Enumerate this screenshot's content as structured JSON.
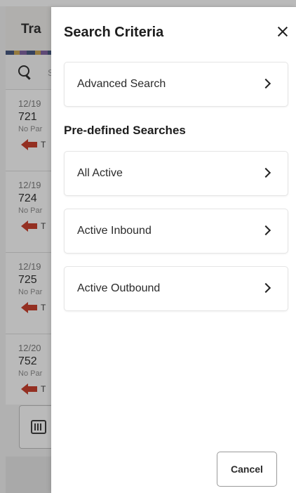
{
  "background": {
    "title": "Tra",
    "search_placeholder": "S",
    "rows": [
      {
        "date": "12/19",
        "number": "721",
        "party": "No Par",
        "type": "T"
      },
      {
        "date": "12/19",
        "number": "724",
        "party": "No Par",
        "type": "T"
      },
      {
        "date": "12/19",
        "number": "725",
        "party": "No Par",
        "type": "T"
      },
      {
        "date": "12/20",
        "number": "752",
        "party": "No Par",
        "type": "T"
      }
    ]
  },
  "drawer": {
    "title": "Search Criteria",
    "advanced_search_label": "Advanced Search",
    "predefined_heading": "Pre-defined Searches",
    "predefined_items": [
      {
        "label": "All Active"
      },
      {
        "label": "Active Inbound"
      },
      {
        "label": "Active Outbound"
      }
    ],
    "cancel_label": "Cancel"
  },
  "colors": {
    "inbound_arrow": "#c8341f",
    "overlay": "rgba(40,40,40,0.32)"
  },
  "icons": [
    "search-icon",
    "arrow-left-icon",
    "barcode-scan-icon",
    "close-icon",
    "chevron-right-icon"
  ]
}
